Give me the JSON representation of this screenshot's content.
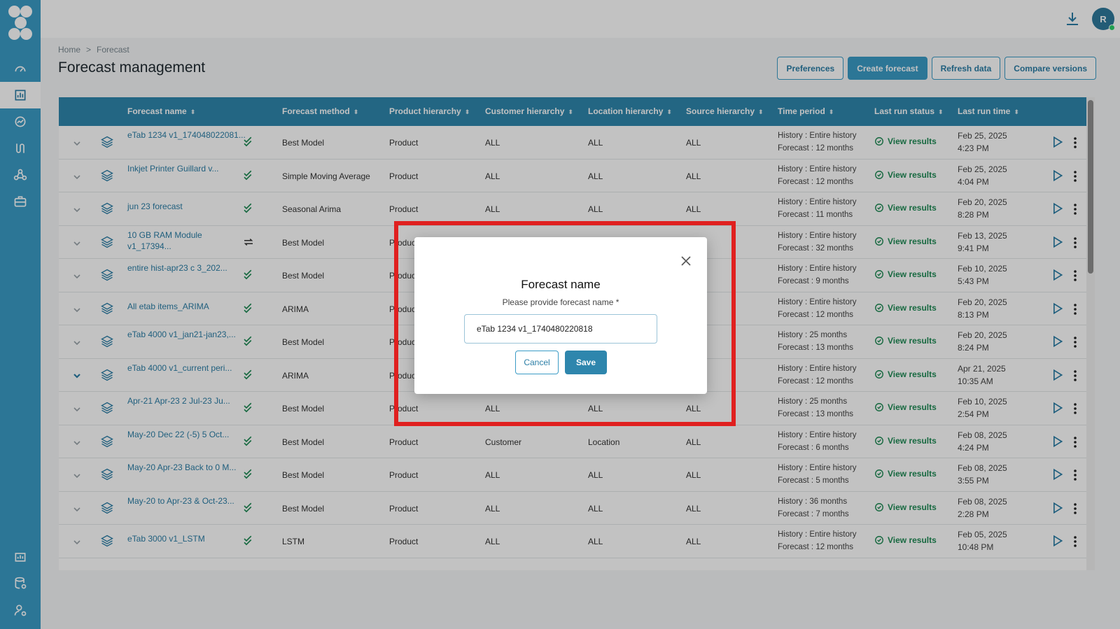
{
  "topbar": {
    "avatar_initial": "R",
    "download_icon": "download-icon"
  },
  "breadcrumb": {
    "home": "Home",
    "separator": ">",
    "current": "Forecast"
  },
  "page": {
    "title": "Forecast management"
  },
  "actions": {
    "preferences": "Preferences",
    "create": "Create forecast",
    "refresh": "Refresh data",
    "compare": "Compare versions"
  },
  "columns": {
    "name": "Forecast name",
    "method": "Forecast method",
    "product": "Product hierarchy",
    "customer": "Customer hierarchy",
    "location": "Location hierarchy",
    "source": "Source hierarchy",
    "period": "Time period",
    "status": "Last run status",
    "time": "Last run time",
    "sort_glyph": "⬍"
  },
  "rows": [
    {
      "name": "eTab 1234 v1_174048022081...",
      "method": "Best Model",
      "product": "Product",
      "customer": "ALL",
      "location": "ALL",
      "source": "ALL",
      "hist": "History : Entire history",
      "fc": "Forecast : 12 months",
      "status": "View results",
      "date": "Feb 25, 2025",
      "time": "4:23 PM",
      "state": "done"
    },
    {
      "name": "Inkjet Printer Guillard v...",
      "method": "Simple Moving Average",
      "product": "Product",
      "customer": "ALL",
      "location": "ALL",
      "source": "ALL",
      "hist": "History : Entire history",
      "fc": "Forecast : 12 months",
      "status": "View results",
      "date": "Feb 25, 2025",
      "time": "4:04 PM",
      "state": "done"
    },
    {
      "name": "jun 23 forecast",
      "method": "Seasonal Arima",
      "product": "Product",
      "customer": "ALL",
      "location": "ALL",
      "source": "ALL",
      "hist": "History : Entire history",
      "fc": "Forecast : 11 months",
      "status": "View results",
      "date": "Feb 20, 2025",
      "time": "8:28 PM",
      "state": "done"
    },
    {
      "name": "10 GB RAM Module v1_17394...",
      "method": "Best Model",
      "product": "Product",
      "customer": "",
      "location": "",
      "source": "",
      "hist": "History : Entire history",
      "fc": "Forecast : 32 months",
      "status": "View results",
      "date": "Feb 13, 2025",
      "time": "9:41 PM",
      "state": "sync"
    },
    {
      "name": "entire hist-apr23 c 3_202...",
      "method": "Best Model",
      "product": "Product",
      "customer": "",
      "location": "",
      "source": "",
      "hist": "History : Entire history",
      "fc": "Forecast : 9 months",
      "status": "View results",
      "date": "Feb 10, 2025",
      "time": "5:43 PM",
      "state": "done"
    },
    {
      "name": "All etab items_ARIMA",
      "method": "ARIMA",
      "product": "Product",
      "customer": "",
      "location": "",
      "source": "",
      "hist": "History : Entire history",
      "fc": "Forecast : 12 months",
      "status": "View results",
      "date": "Feb 20, 2025",
      "time": "8:13 PM",
      "state": "done"
    },
    {
      "name": "eTab 4000 v1_jan21-jan23,...",
      "method": "Best Model",
      "product": "Product",
      "customer": "",
      "location": "",
      "source": "",
      "hist": "History : 25 months",
      "fc": "Forecast : 13 months",
      "status": "View results",
      "date": "Feb 20, 2025",
      "time": "8:24 PM",
      "state": "done"
    },
    {
      "name": "eTab 4000 v1_current peri...",
      "method": "ARIMA",
      "product": "Product",
      "customer": "",
      "location": "",
      "source": "",
      "hist": "History : Entire history",
      "fc": "Forecast : 12 months",
      "status": "View results",
      "date": "Apr 21, 2025",
      "time": "10:35 AM",
      "state": "done",
      "expanded": true
    },
    {
      "name": "Apr-21    Apr-23    2    Jul-23 Ju...",
      "method": "Best Model",
      "product": "Product",
      "customer": "ALL",
      "location": "ALL",
      "source": "ALL",
      "hist": "History : 25 months",
      "fc": "Forecast : 13 months",
      "status": "View results",
      "date": "Feb 10, 2025",
      "time": "2:54 PM",
      "state": "done"
    },
    {
      "name": "May-20    Dec 22 (-5)    5 Oct...",
      "method": "Best Model",
      "product": "Product",
      "customer": "Customer",
      "location": "Location",
      "source": "ALL",
      "hist": "History : Entire history",
      "fc": "Forecast : 6 months",
      "status": "View results",
      "date": "Feb 08, 2025",
      "time": "4:24 PM",
      "state": "done"
    },
    {
      "name": "May-20    Apr-23    Back to 0 M...",
      "method": "Best Model",
      "product": "Product",
      "customer": "ALL",
      "location": "ALL",
      "source": "ALL",
      "hist": "History : Entire history",
      "fc": "Forecast : 5 months",
      "status": "View results",
      "date": "Feb 08, 2025",
      "time": "3:55 PM",
      "state": "done"
    },
    {
      "name": "May-20 to Apr-23 & Oct-23...",
      "method": "Best Model",
      "product": "Product",
      "customer": "ALL",
      "location": "ALL",
      "source": "ALL",
      "hist": "History : 36 months",
      "fc": "Forecast : 7 months",
      "status": "View results",
      "date": "Feb 08, 2025",
      "time": "2:28 PM",
      "state": "done"
    },
    {
      "name": "eTab 3000 v1_LSTM",
      "method": "LSTM",
      "product": "Product",
      "customer": "ALL",
      "location": "ALL",
      "source": "ALL",
      "hist": "History : Entire history",
      "fc": "Forecast : 12 months",
      "status": "View results",
      "date": "Feb 05, 2025",
      "time": "10:48 PM",
      "state": "done"
    }
  ],
  "modal": {
    "title": "Forecast name",
    "label": "Please provide forecast name *",
    "value": "eTab 1234 v1_1740480220818",
    "cancel": "Cancel",
    "save": "Save"
  },
  "colors": {
    "sidebar": "#3b9bc6",
    "header": "#2e86ad",
    "success": "#1f8a55",
    "highlight": "#e0201f"
  }
}
